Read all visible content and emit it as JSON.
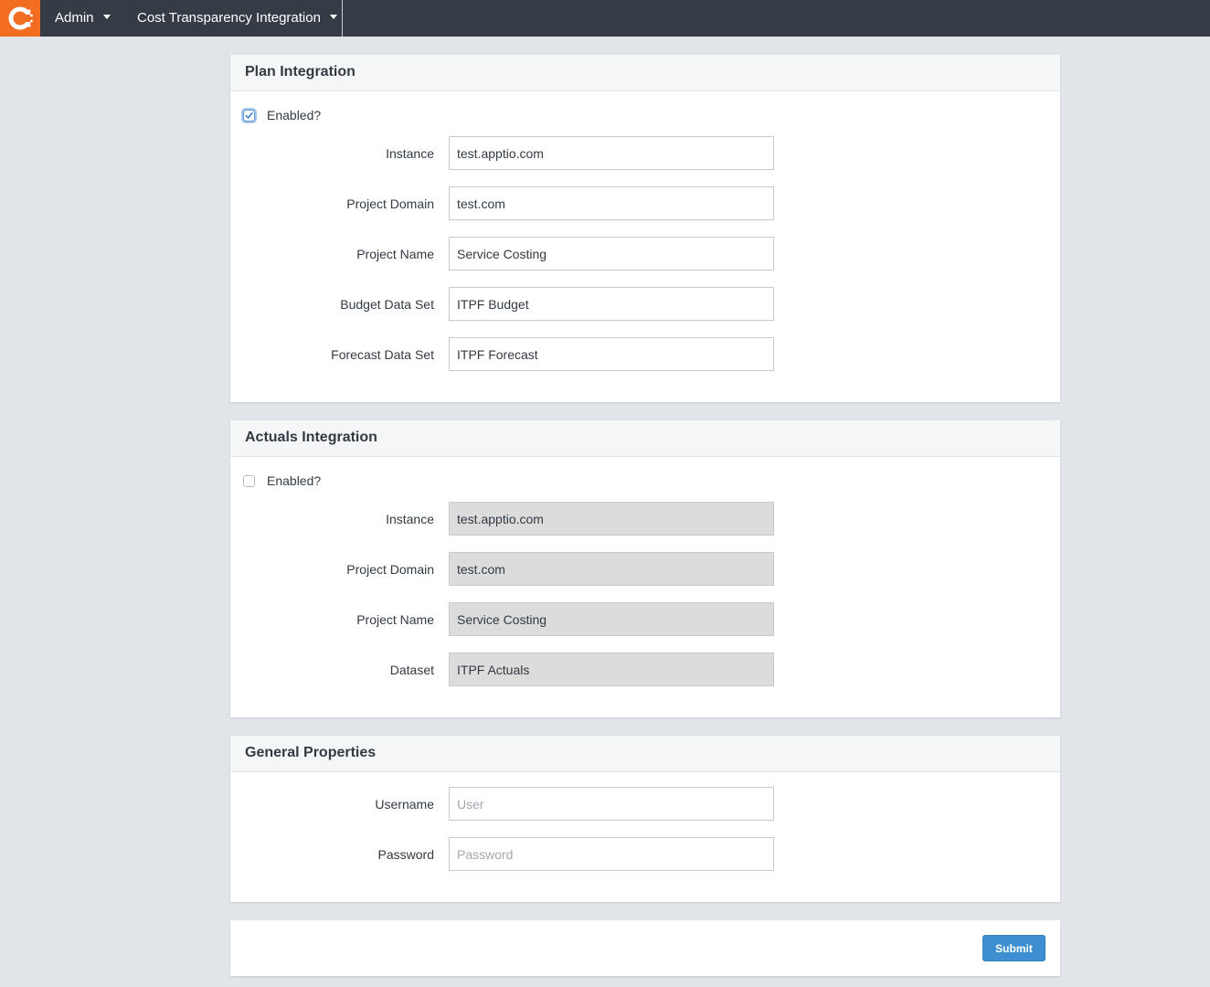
{
  "nav": {
    "admin_label": "Admin",
    "integration_label": "Cost Transparency Integration"
  },
  "colors": {
    "nav_background": "#353c45",
    "logo_accent": "#f26d21",
    "page_background": "#e1e4e8",
    "submit_button": "#3d8fd1"
  },
  "plan": {
    "title": "Plan Integration",
    "enabled_label": "Enabled?",
    "enabled": true,
    "fields": [
      {
        "label": "Instance",
        "value": "test.apptio.com"
      },
      {
        "label": "Project Domain",
        "value": "test.com"
      },
      {
        "label": "Project Name",
        "value": "Service Costing"
      },
      {
        "label": "Budget Data Set",
        "value": "ITPF Budget"
      },
      {
        "label": "Forecast Data Set",
        "value": "ITPF Forecast"
      }
    ]
  },
  "actuals": {
    "title": "Actuals Integration",
    "enabled_label": "Enabled?",
    "enabled": false,
    "fields": [
      {
        "label": "Instance",
        "value": "test.apptio.com"
      },
      {
        "label": "Project Domain",
        "value": "test.com"
      },
      {
        "label": "Project Name",
        "value": "Service Costing"
      },
      {
        "label": "Dataset",
        "value": "ITPF Actuals"
      }
    ]
  },
  "general": {
    "title": "General Properties",
    "fields": [
      {
        "label": "Username",
        "value": "",
        "placeholder": "User"
      },
      {
        "label": "Password",
        "value": "",
        "placeholder": "Password"
      }
    ]
  },
  "footer": {
    "submit_label": "Submit"
  }
}
